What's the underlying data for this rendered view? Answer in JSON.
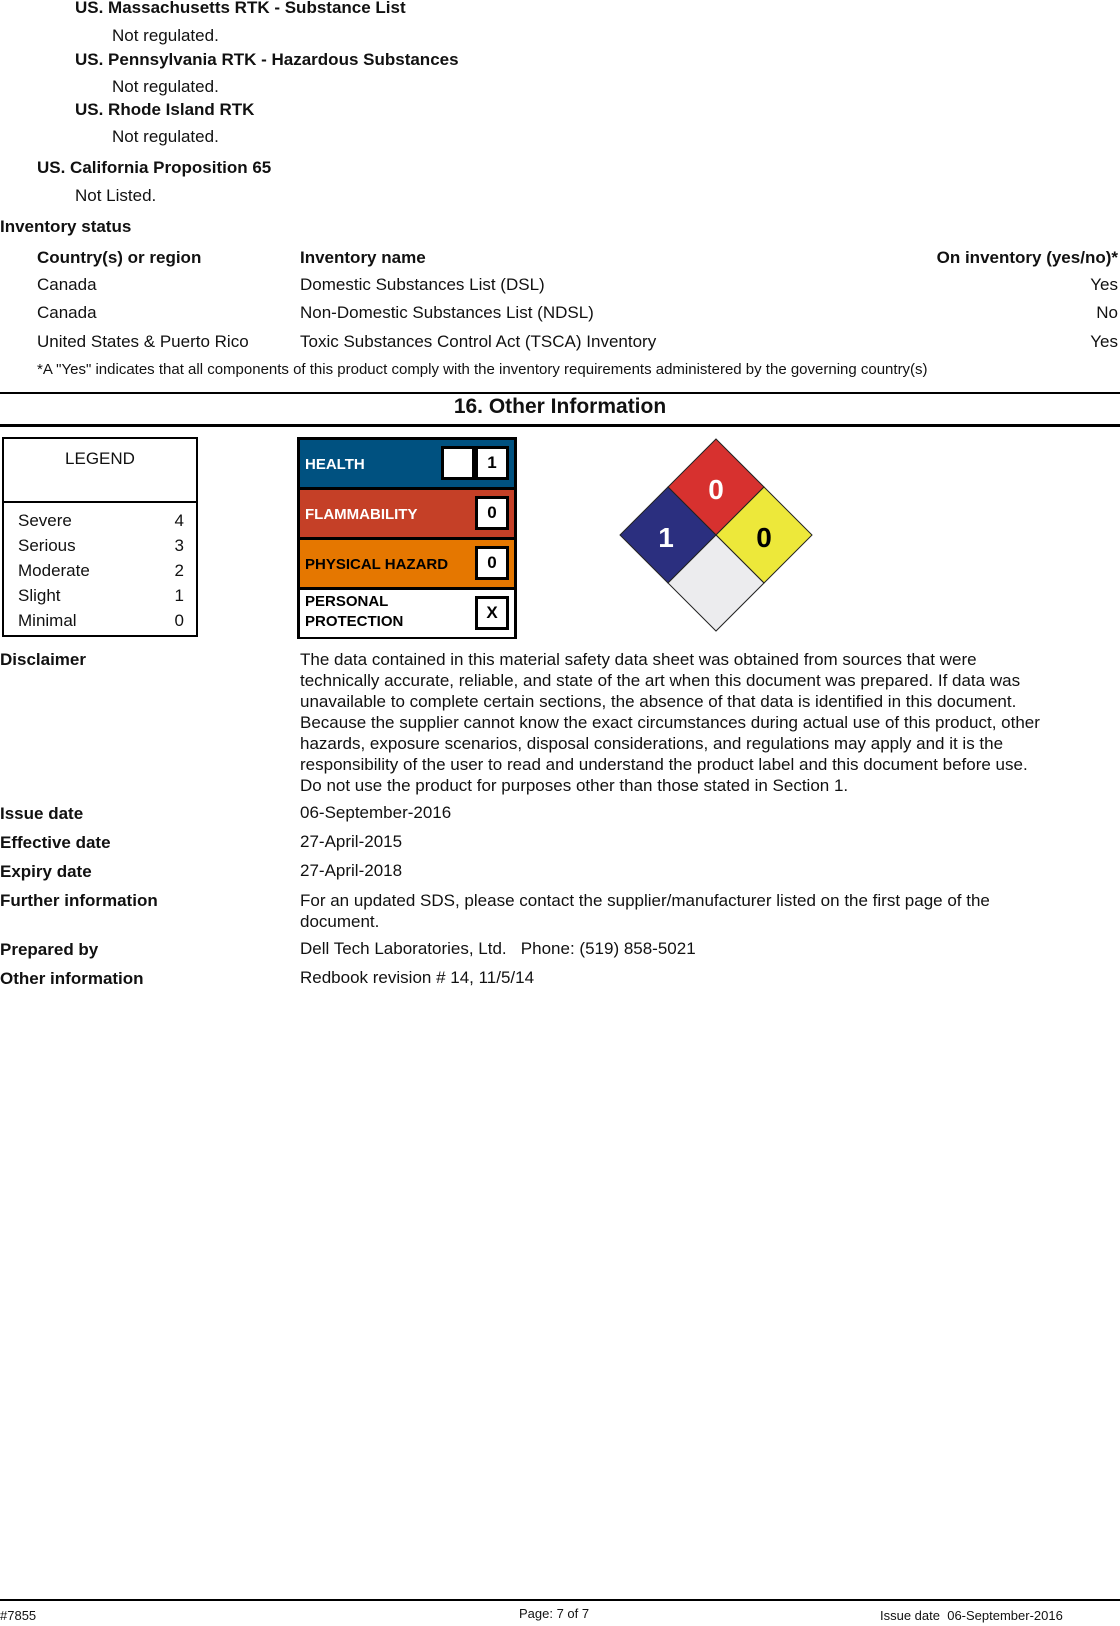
{
  "regulations": {
    "state_items": [
      {
        "title": "US. Massachusetts RTK - Substance List",
        "value": "Not regulated."
      },
      {
        "title": "US. Pennsylvania RTK - Hazardous Substances",
        "value": "Not regulated."
      },
      {
        "title": "US. Rhode Island RTK",
        "value": "Not regulated."
      }
    ],
    "prop65": {
      "title": "US. California Proposition 65",
      "value": "Not Listed."
    }
  },
  "inventory": {
    "title": "Inventory status",
    "headers": [
      "Country(s) or region",
      "Inventory name",
      "On inventory (yes/no)*"
    ],
    "rows": [
      [
        "Canada",
        "Domestic Substances List (DSL)",
        "Yes"
      ],
      [
        "Canada",
        "Non-Domestic Substances List (NDSL)",
        "No"
      ],
      [
        "United States & Puerto Rico",
        "Toxic Substances Control Act (TSCA) Inventory",
        "Yes"
      ]
    ],
    "footnote": "*A \"Yes\" indicates that all components of this product comply with the inventory requirements administered by the governing country(s)"
  },
  "section16": {
    "title": "16. Other Information",
    "legend": {
      "title": "LEGEND",
      "rows": [
        {
          "label": "Severe",
          "value": "4"
        },
        {
          "label": "Serious",
          "value": "3"
        },
        {
          "label": "Moderate",
          "value": "2"
        },
        {
          "label": "Slight",
          "value": "1"
        },
        {
          "label": "Minimal",
          "value": "0"
        }
      ]
    },
    "hmis": {
      "health": {
        "label": "HEALTH",
        "chronic": "/",
        "value": "1",
        "color": "#005180"
      },
      "flammability": {
        "label": "FLAMMABILITY",
        "value": "0",
        "color": "#c54027"
      },
      "physical": {
        "label": "PHYSICAL HAZARD",
        "value": "0",
        "color": "#e57700"
      },
      "ppe": {
        "label_line1": "PERSONAL",
        "label_line2": "PROTECTION",
        "value": "X",
        "color": "#ffffff"
      }
    },
    "nfpa": {
      "flammability": {
        "value": "0",
        "color": "#d7312f"
      },
      "health": {
        "value": "1",
        "color": "#2b2f7f"
      },
      "instability": {
        "value": "0",
        "color": "#ede83a"
      },
      "special": {
        "value": "",
        "color": "#ececee"
      }
    },
    "fields": [
      {
        "label": "Disclaimer",
        "lines": [
          "The data contained in this material safety data sheet was obtained from sources that were",
          "technically accurate, reliable, and state of the art when this document was prepared.  If data was",
          "unavailable to complete certain sections, the absence of that data is identified in this document.",
          "Because the supplier cannot know the exact circumstances during actual use of this product, other",
          "hazards, exposure scenarios, disposal considerations, and regulations may apply and it is the",
          "responsibility of the user to read and understand the product label and this document before use.",
          "Do not use the product for purposes other than those stated in Section 1."
        ]
      },
      {
        "label": "Issue date",
        "lines": [
          "06-September-2016"
        ]
      },
      {
        "label": "Effective date",
        "lines": [
          "27-April-2015"
        ]
      },
      {
        "label": "Expiry date",
        "lines": [
          "27-April-2018"
        ]
      },
      {
        "label": "Further information",
        "lines": [
          "For an updated SDS, please contact the supplier/manufacturer listed on the first page of the",
          "document."
        ]
      },
      {
        "label": "Prepared by",
        "lines": [
          "Dell Tech Laboratories, Ltd.   Phone: (519) 858-5021"
        ]
      },
      {
        "label": "Other information",
        "lines": [
          "Redbook revision # 14, 11/5/14"
        ]
      }
    ]
  },
  "footer": {
    "doc_number": "#7855",
    "page": "Page: 7 of 7",
    "issue_date": "Issue date  06-September-2016"
  }
}
